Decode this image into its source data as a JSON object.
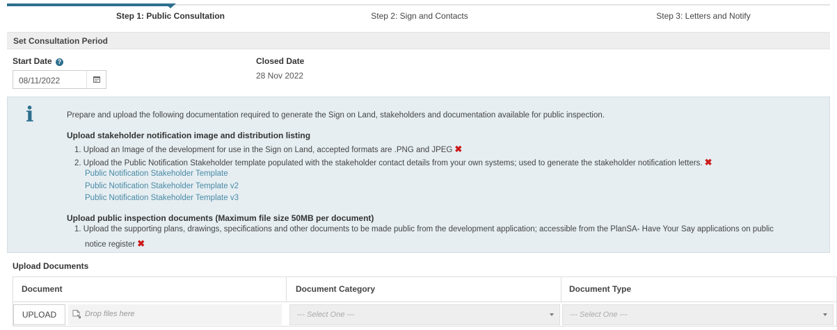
{
  "stepper": {
    "steps": [
      {
        "label": "Step 1: Public Consultation",
        "active": true
      },
      {
        "label": "Step 2: Sign and Contacts",
        "active": false
      },
      {
        "label": "Step 3: Letters and Notify",
        "active": false
      }
    ],
    "accent_color": "#2e6f8e"
  },
  "consultation": {
    "section_title": "Set Consultation Period",
    "start_date_label": "Start Date",
    "start_date_help_icon": "question-circle-icon",
    "start_date_value": "08/11/2022",
    "calendar_icon": "calendar-icon",
    "closed_date_label": "Closed Date",
    "closed_date_value": "28 Nov 2022"
  },
  "info": {
    "icon": "info-icon",
    "intro": "Prepare and upload the following documentation required to generate the Sign on Land, stakeholders and documentation available for public inspection.",
    "heading1": "Upload stakeholder notification image and distribution listing",
    "item1": "1. Upload an Image of the development for use in the Sign on Land, accepted formats are .PNG and JPEG",
    "item2": "2. Upload the Public Notification Stakeholder template populated with the stakeholder contact details from your own systems; used to generate the stakeholder notification letters.",
    "links": [
      "Public Notification Stakeholder Template",
      "Public Notification Stakeholder Template v2",
      "Public Notification Stakeholder Template v3"
    ],
    "heading2": "Upload public inspection documents (Maximum file size 50MB per document)",
    "item3_line1": "1. Upload the supporting plans, drawings, specifications and other documents to be made public from the development application; accessible from the PlanSA- Have Your Say applications on public",
    "item3_line2": "notice register",
    "missing_mark": "✖",
    "missing_color": "#cc1a1a"
  },
  "upload": {
    "title": "Upload Documents",
    "columns": [
      "Document",
      "Document Category",
      "Document Type"
    ],
    "upload_button": "UPLOAD",
    "drop_placeholder": "Drop files here",
    "category_placeholder": "--- Select One ---",
    "type_placeholder": "--- Select One ---"
  }
}
